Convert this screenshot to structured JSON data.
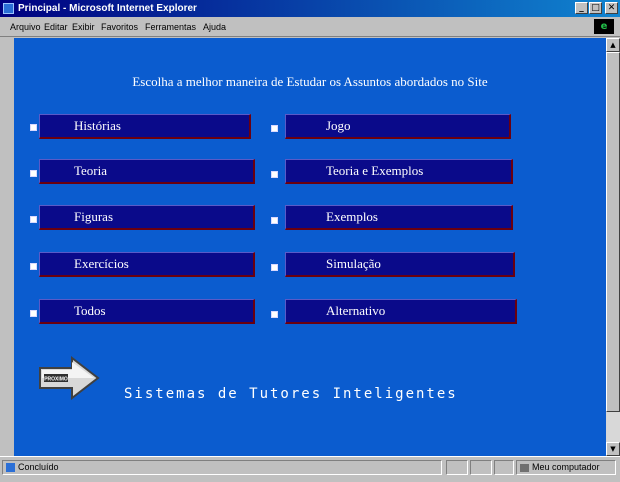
{
  "window": {
    "title": "Principal - Microsoft Internet Explorer",
    "controls": {
      "minimize": "_",
      "maximize": "□",
      "close": "✕"
    }
  },
  "menubar": {
    "items": [
      "Arquivo",
      "Editar",
      "Exibir",
      "Favoritos",
      "Ferramentas",
      "Ajuda"
    ],
    "throbber": "e"
  },
  "page": {
    "headline": "Escolha  a melhor maneira de Estudar os Assuntos abordados no Site",
    "options_left": [
      "Histórias",
      "Teoria",
      "Figuras",
      "Exercícios",
      "Todos"
    ],
    "options_right": [
      "Jogo",
      "Teoria e Exemplos",
      "Exemplos",
      "Simulação",
      "Alternativo"
    ],
    "next_button_label": "PROXIMO",
    "footer_title": "Sistemas de Tutores Inteligentes"
  },
  "statusbar": {
    "status_text": "Concluído",
    "zone_text": "Meu computador"
  },
  "colors": {
    "page_background": "#0b5ccf",
    "button_fill": "#0a0a8a",
    "button_border": "#6a0010",
    "text": "#ffffff"
  }
}
